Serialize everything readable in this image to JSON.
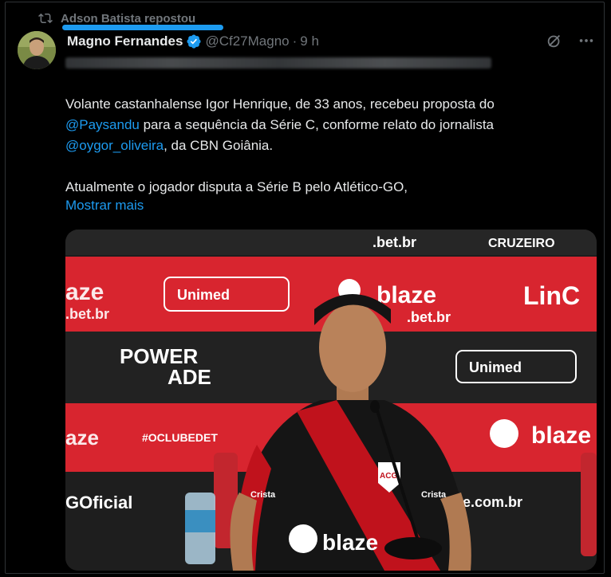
{
  "repost": {
    "label": "Adson Batista repostou",
    "icon": "repost-icon"
  },
  "author": {
    "name": "Magno Fernandes",
    "handle": "@Cf27Magno",
    "separator": "·",
    "time": "9 h",
    "verified": true
  },
  "actions": {
    "grok_icon": "grok-icon",
    "more_icon": "more-icon"
  },
  "post": {
    "line1_before": "Volante castanhalense Igor Henrique, de 33 anos, recebeu proposta do",
    "mention1": "@Paysandu",
    "line2_after": " para a sequência da Série C, conforme relato do jornalista",
    "mention2": "@oygor_oliveira",
    "line3_after": ", da CBN Goiânia.",
    "paragraph2": "Atualmente o jogador disputa a Série B pelo Atlético-GO,",
    "show_more": "Mostrar mais"
  },
  "media": {
    "backdrop": {
      "blaze": "blaze",
      "betbr": ".bet.br",
      "unimed": "Unimed",
      "cruzeiro": "CRUZEIRO",
      "powerade_1": "POWER",
      "powerade_2": "ADE",
      "linc": "LinC",
      "hashtag": "#OCLUBEDET",
      "goficial": "GOficial",
      "com_br": "e.com.br",
      "ze": "aze",
      "crista": "Crista",
      "acg": "ACG"
    },
    "colors": {
      "red": "#d8252f",
      "dark": "#222222",
      "jersey_red": "#c0121c",
      "jersey_black": "#151515"
    }
  }
}
